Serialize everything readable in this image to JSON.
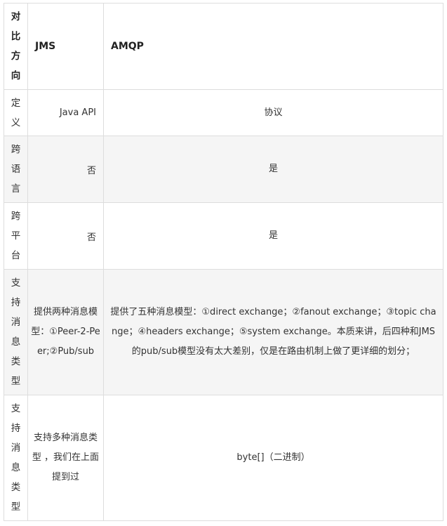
{
  "header": {
    "dim_chars": [
      "对",
      "比",
      "方",
      "向"
    ],
    "col_jms": "JMS",
    "col_amqp": "AMQP"
  },
  "rows": [
    {
      "dim_chars": [
        "定",
        "义"
      ],
      "jms": "Java API",
      "amqp": "协议"
    },
    {
      "dim_chars": [
        "跨",
        "语",
        "言"
      ],
      "jms": "否",
      "amqp": "是"
    },
    {
      "dim_chars": [
        "跨",
        "平",
        "台"
      ],
      "jms": "否",
      "amqp": "是"
    },
    {
      "dim_chars": [
        "支",
        "持",
        "消",
        "息",
        "类",
        "型"
      ],
      "jms": "提供两种消息模型：①Peer-2-Peer;②Pub/sub",
      "amqp": "提供了五种消息模型：①direct exchange；②fanout exchange；③topic change；④headers exchange；⑤system exchange。本质来讲，后四种和JMS的pub/sub模型没有太大差别，仅是在路由机制上做了更详细的划分；"
    },
    {
      "dim_chars": [
        "支",
        "持",
        "消",
        "息",
        "类",
        "型"
      ],
      "jms": "支持多种消息类型 ，我们在上面提到过",
      "amqp": "byte[]（二进制）"
    }
  ]
}
